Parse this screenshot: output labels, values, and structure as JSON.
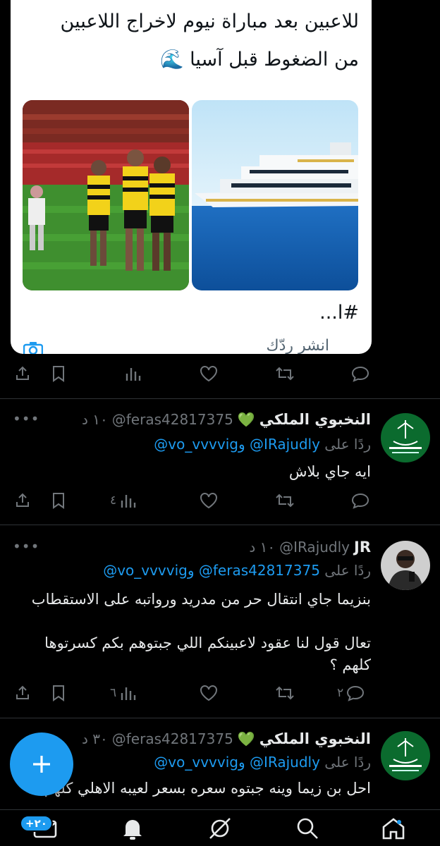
{
  "quote": {
    "line1": "للاعبين بعد مباراة نيوم لاخراج اللاعبين",
    "line2": "من الضغوط قبل آسيا 🌊",
    "hashtag": "#ا...",
    "reply_hint": "انشر ردّك",
    "image_left_alt": "football-players",
    "image_right_alt": "yacht-at-sea"
  },
  "tweets": [
    {
      "display_name": "النخبوي الملكي",
      "badge": "💚",
      "handle": "@feras42817375",
      "time": "١٠ د",
      "reply_prefix": "ردًا على",
      "mention1": "@IRajudly",
      "mention_sep": "و",
      "mention2": "@vo_vvvvig",
      "body": "ايه جاي بلاش",
      "replies": "",
      "retweets": "",
      "likes": "",
      "views": "٤"
    },
    {
      "display_name": "JR",
      "badge": "",
      "handle": "@IRajudly",
      "time": "١٠ د",
      "reply_prefix": "ردًا على",
      "mention1": "@feras42817375",
      "mention_sep": "و",
      "mention2": "@vo_vvvvig",
      "body": "بنزيما جاي انتقال حر من مدريد ورواتبه على الاستقطاب\n\nتعال قول لنا عقود لاعبينكم اللي جبتوهم بكم كسرتوها كلهم ؟",
      "replies": "٢",
      "retweets": "",
      "likes": "",
      "views": "٦"
    },
    {
      "display_name": "النخبوي الملكي",
      "badge": "💚",
      "handle": "@feras42817375",
      "time": "٣٠ د",
      "reply_prefix": "ردًا على",
      "mention1": "@IRajudly",
      "mention_sep": "و",
      "mention2": "@vo_vvvvig",
      "body": "احل بن زيما وينه جبتوه سعره بسعر لعيبه الاهلي كلهم"
    }
  ],
  "nav": {
    "badge": "+٢٠",
    "items": [
      "home",
      "search",
      "grok",
      "notifications",
      "messages"
    ]
  },
  "colors": {
    "accent": "#1d9bf0",
    "background": "#000000",
    "muted": "#71767b",
    "green": "#00ba7c"
  }
}
